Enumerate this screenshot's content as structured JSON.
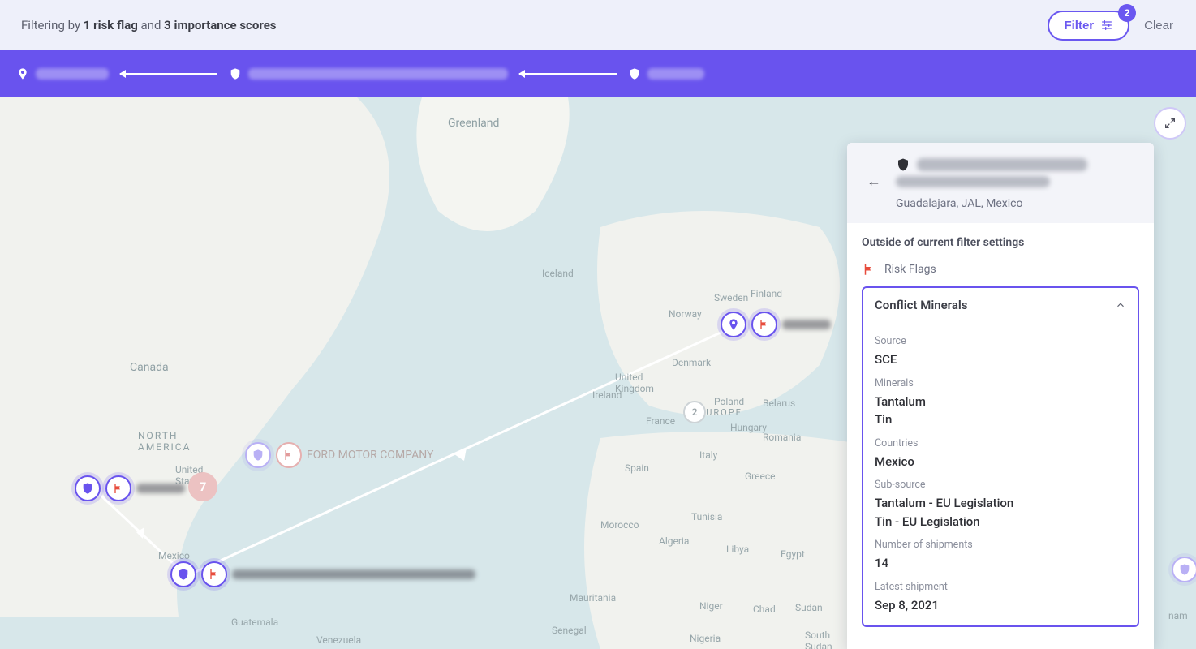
{
  "filterBar": {
    "prefix": "Filtering by ",
    "bold1": "1 risk flag",
    "mid": " and ",
    "bold2": "3 importance scores",
    "filterLabel": "Filter",
    "filterCount": "2",
    "clearLabel": "Clear"
  },
  "breadcrumb": {
    "node1WidthPx": 90,
    "node2WidthPx": 320,
    "node3WidthPx": 70
  },
  "map": {
    "labels": {
      "greenland": "Greenland",
      "iceland": "Iceland",
      "norway": "Norway",
      "sweden": "Sweden",
      "finland": "Finland",
      "denmark": "Denmark",
      "uk": "United\nKingdom",
      "ireland": "Ireland",
      "poland": "Poland",
      "belarus": "Belarus",
      "france": "France",
      "spain": "Spain",
      "italy": "Italy",
      "hungary": "Hungary",
      "romania": "Romania",
      "greece": "Greece",
      "morocco": "Morocco",
      "algeria": "Algeria",
      "tunisia": "Tunisia",
      "libya": "Libya",
      "egypt": "Egypt",
      "mauritania": "Mauritania",
      "senegal": "Senegal",
      "niger": "Niger",
      "chad": "Chad",
      "sudan": "Sudan",
      "nigeria": "Nigeria",
      "southSudan": "South\nSudan",
      "canada": "Canada",
      "northAmerica": "NORTH\nAMERICA",
      "usa": "United\nStates",
      "mexico": "Mexico",
      "guatemala": "Guatemala",
      "venezuela": "Venezuela",
      "europe": "EUROPE",
      "nam": "nam"
    },
    "fordLabel": "FORD MOTOR COMPANY",
    "redCount": "7",
    "europeCount": "2"
  },
  "panel": {
    "location": "Guadalajara, JAL, Mexico",
    "outsideNote": "Outside of current filter settings",
    "riskFlagsLabel": "Risk Flags",
    "accordionTitle": "Conflict Minerals",
    "fields": {
      "sourceLabel": "Source",
      "sourceValue": "SCE",
      "mineralsLabel": "Minerals",
      "mineralsValue1": "Tantalum",
      "mineralsValue2": "Tin",
      "countriesLabel": "Countries",
      "countriesValue": "Mexico",
      "subSourceLabel": "Sub-source",
      "subSourceValue1": "Tantalum - EU Legislation",
      "subSourceValue2": "Tin - EU Legislation",
      "shipmentsLabel": "Number of shipments",
      "shipmentsValue": "14",
      "latestLabel": "Latest shipment",
      "latestValue": "Sep 8, 2021"
    }
  }
}
